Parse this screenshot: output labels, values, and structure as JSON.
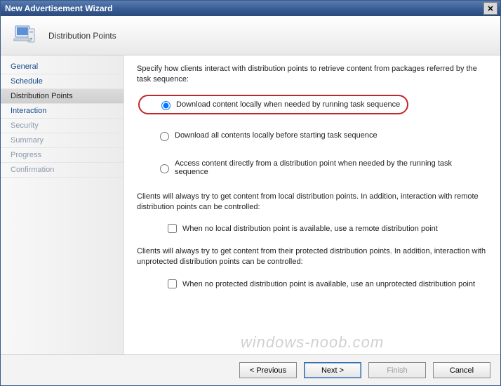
{
  "window": {
    "title": "New Advertisement Wizard",
    "close_glyph": "✕"
  },
  "header": {
    "page_title": "Distribution Points"
  },
  "nav": {
    "items": [
      {
        "label": "General",
        "state": "normal"
      },
      {
        "label": "Schedule",
        "state": "normal"
      },
      {
        "label": "Distribution Points",
        "state": "active"
      },
      {
        "label": "Interaction",
        "state": "normal"
      },
      {
        "label": "Security",
        "state": "disabled"
      },
      {
        "label": "Summary",
        "state": "disabled"
      },
      {
        "label": "Progress",
        "state": "disabled"
      },
      {
        "label": "Confirmation",
        "state": "disabled"
      }
    ]
  },
  "content": {
    "instruction": "Specify how clients interact with distribution points to retrieve content from packages referred by the task sequence:",
    "radios": {
      "download_when_needed": "Download content locally when needed by running task sequence",
      "download_before_start": "Download all contents locally before starting task sequence",
      "access_direct": "Access content directly from a distribution point when needed by the running task sequence",
      "selected": "download_when_needed"
    },
    "note_remote": "Clients will always try to get content from local distribution points. In addition, interaction with remote distribution points can be controlled:",
    "check_remote": "When no local distribution point is available, use a remote distribution point",
    "note_unprotected": "Clients will always try to get content from their protected distribution points. In addition, interaction with unprotected distribution points can be controlled:",
    "check_unprotected": "When no protected distribution point is available, use an unprotected distribution point"
  },
  "footer": {
    "previous": "< Previous",
    "next": "Next >",
    "finish": "Finish",
    "cancel": "Cancel"
  },
  "watermark": "windows-noob.com"
}
